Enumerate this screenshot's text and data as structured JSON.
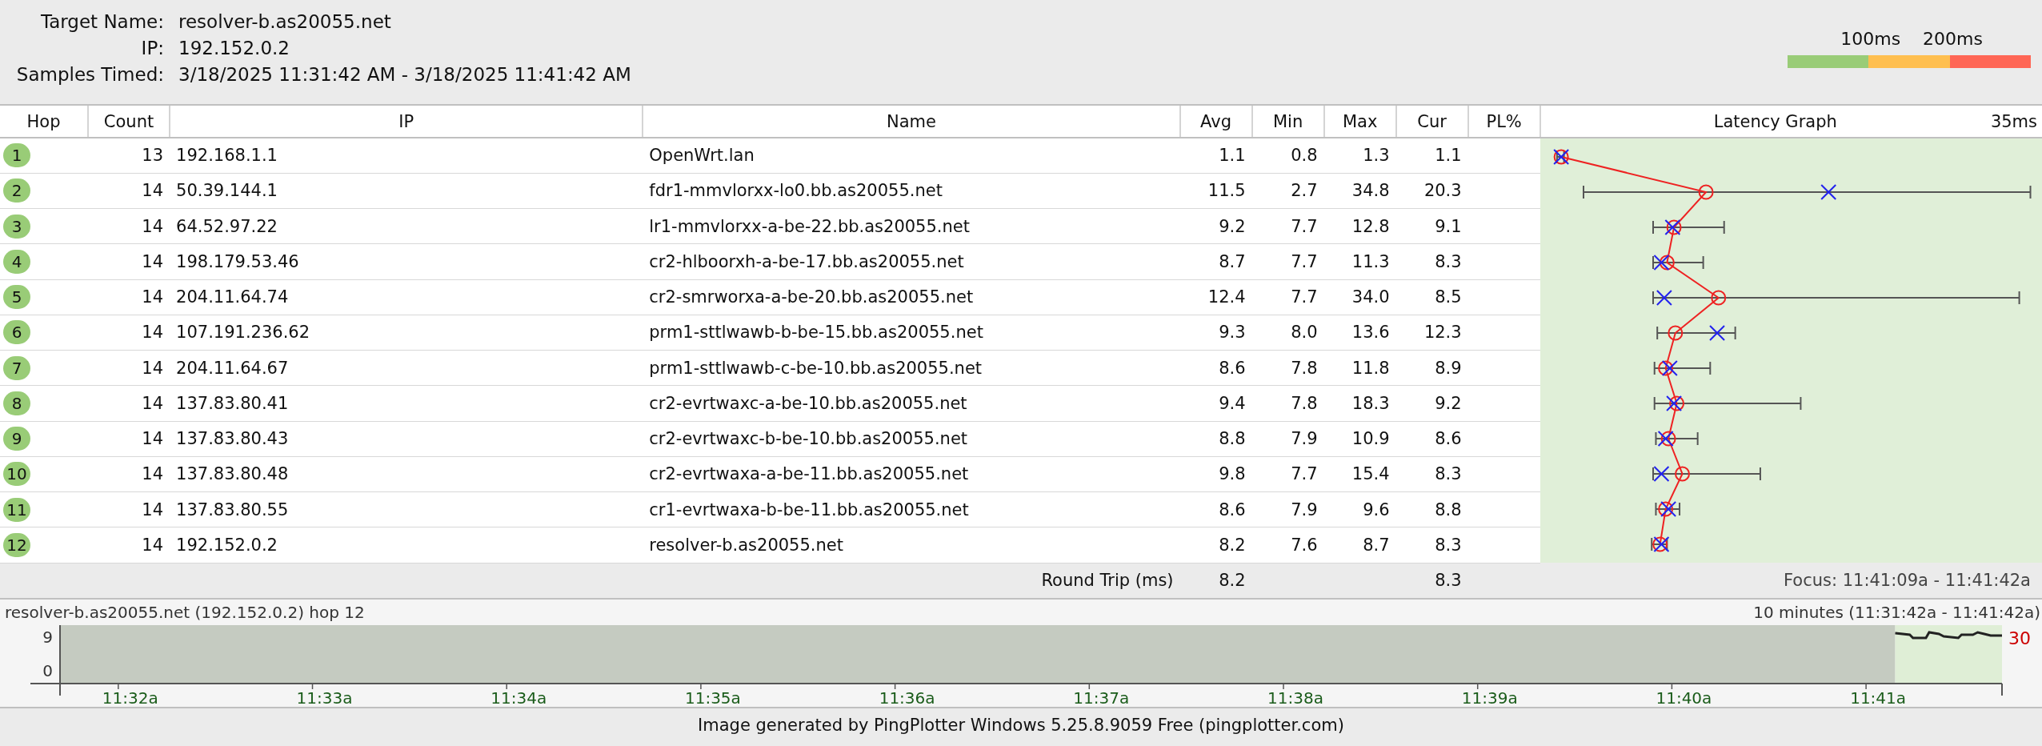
{
  "target": {
    "fields": [
      {
        "label": "Target Name:",
        "value": "resolver-b.as20055.net"
      },
      {
        "label": "IP:",
        "value": "192.152.0.2"
      },
      {
        "label": "Samples Timed:",
        "value": "3/18/2025 11:31:42 AM - 3/18/2025 11:41:42 AM"
      }
    ]
  },
  "legend": {
    "labels": [
      "100ms",
      "200ms"
    ],
    "segments": [
      {
        "color": "#99cc77"
      },
      {
        "color": "#ffbf50"
      },
      {
        "color": "#ff6655"
      }
    ]
  },
  "table": {
    "columns": [
      "Hop",
      "Count",
      "IP",
      "Name",
      "Avg",
      "Min",
      "Max",
      "Cur",
      "PL%"
    ],
    "graph_header": {
      "title": "Latency Graph",
      "scale": "35ms"
    },
    "rows": [
      {
        "hop": "1",
        "count": "13",
        "ip": "192.168.1.1",
        "name": "OpenWrt.lan",
        "avg": "1.1",
        "min": "0.8",
        "max": "1.3",
        "cur": "1.1"
      },
      {
        "hop": "2",
        "count": "14",
        "ip": "50.39.144.1",
        "name": "fdr1-mmvlorxx-lo0.bb.as20055.net",
        "avg": "11.5",
        "min": "2.7",
        "max": "34.8",
        "cur": "20.3"
      },
      {
        "hop": "3",
        "count": "14",
        "ip": "64.52.97.22",
        "name": "lr1-mmvlorxx-a-be-22.bb.as20055.net",
        "avg": "9.2",
        "min": "7.7",
        "max": "12.8",
        "cur": "9.1"
      },
      {
        "hop": "4",
        "count": "14",
        "ip": "198.179.53.46",
        "name": "cr2-hlboorxh-a-be-17.bb.as20055.net",
        "avg": "8.7",
        "min": "7.7",
        "max": "11.3",
        "cur": "8.3"
      },
      {
        "hop": "5",
        "count": "14",
        "ip": "204.11.64.74",
        "name": "cr2-smrworxa-a-be-20.bb.as20055.net",
        "avg": "12.4",
        "min": "7.7",
        "max": "34.0",
        "cur": "8.5"
      },
      {
        "hop": "6",
        "count": "14",
        "ip": "107.191.236.62",
        "name": "prm1-sttlwawb-b-be-15.bb.as20055.net",
        "avg": "9.3",
        "min": "8.0",
        "max": "13.6",
        "cur": "12.3"
      },
      {
        "hop": "7",
        "count": "14",
        "ip": "204.11.64.67",
        "name": "prm1-sttlwawb-c-be-10.bb.as20055.net",
        "avg": "8.6",
        "min": "7.8",
        "max": "11.8",
        "cur": "8.9"
      },
      {
        "hop": "8",
        "count": "14",
        "ip": "137.83.80.41",
        "name": "cr2-evrtwaxc-a-be-10.bb.as20055.net",
        "avg": "9.4",
        "min": "7.8",
        "max": "18.3",
        "cur": "9.2"
      },
      {
        "hop": "9",
        "count": "14",
        "ip": "137.83.80.43",
        "name": "cr2-evrtwaxc-b-be-10.bb.as20055.net",
        "avg": "8.8",
        "min": "7.9",
        "max": "10.9",
        "cur": "8.6"
      },
      {
        "hop": "10",
        "count": "14",
        "ip": "137.83.80.48",
        "name": "cr2-evrtwaxa-a-be-11.bb.as20055.net",
        "avg": "9.8",
        "min": "7.7",
        "max": "15.4",
        "cur": "8.3"
      },
      {
        "hop": "11",
        "count": "14",
        "ip": "137.83.80.55",
        "name": "cr1-evrtwaxa-b-be-11.bb.as20055.net",
        "avg": "8.6",
        "min": "7.9",
        "max": "9.6",
        "cur": "8.8"
      },
      {
        "hop": "12",
        "count": "14",
        "ip": "192.152.0.2",
        "name": "resolver-b.as20055.net",
        "avg": "8.2",
        "min": "7.6",
        "max": "8.7",
        "cur": "8.3"
      }
    ],
    "summary": {
      "label": "Round Trip (ms)",
      "avg": "8.2",
      "cur": "8.3",
      "focus": "Focus: 11:41:09a - 11:41:42a"
    }
  },
  "timeline": {
    "title": "resolver-b.as20055.net (192.152.0.2) hop 12",
    "range": "10 minutes (11:31:42a - 11:41:42a)",
    "y_labels": [
      "9",
      "0"
    ],
    "right_label": "30",
    "x_ticks": [
      "11:32a",
      "11:33a",
      "11:34a",
      "11:35a",
      "11:36a",
      "11:37a",
      "11:38a",
      "11:39a",
      "11:40a",
      "11:41a"
    ]
  },
  "footer": "Image generated by PingPlotter Windows 5.25.8.9059 Free (pingplotter.com)"
}
